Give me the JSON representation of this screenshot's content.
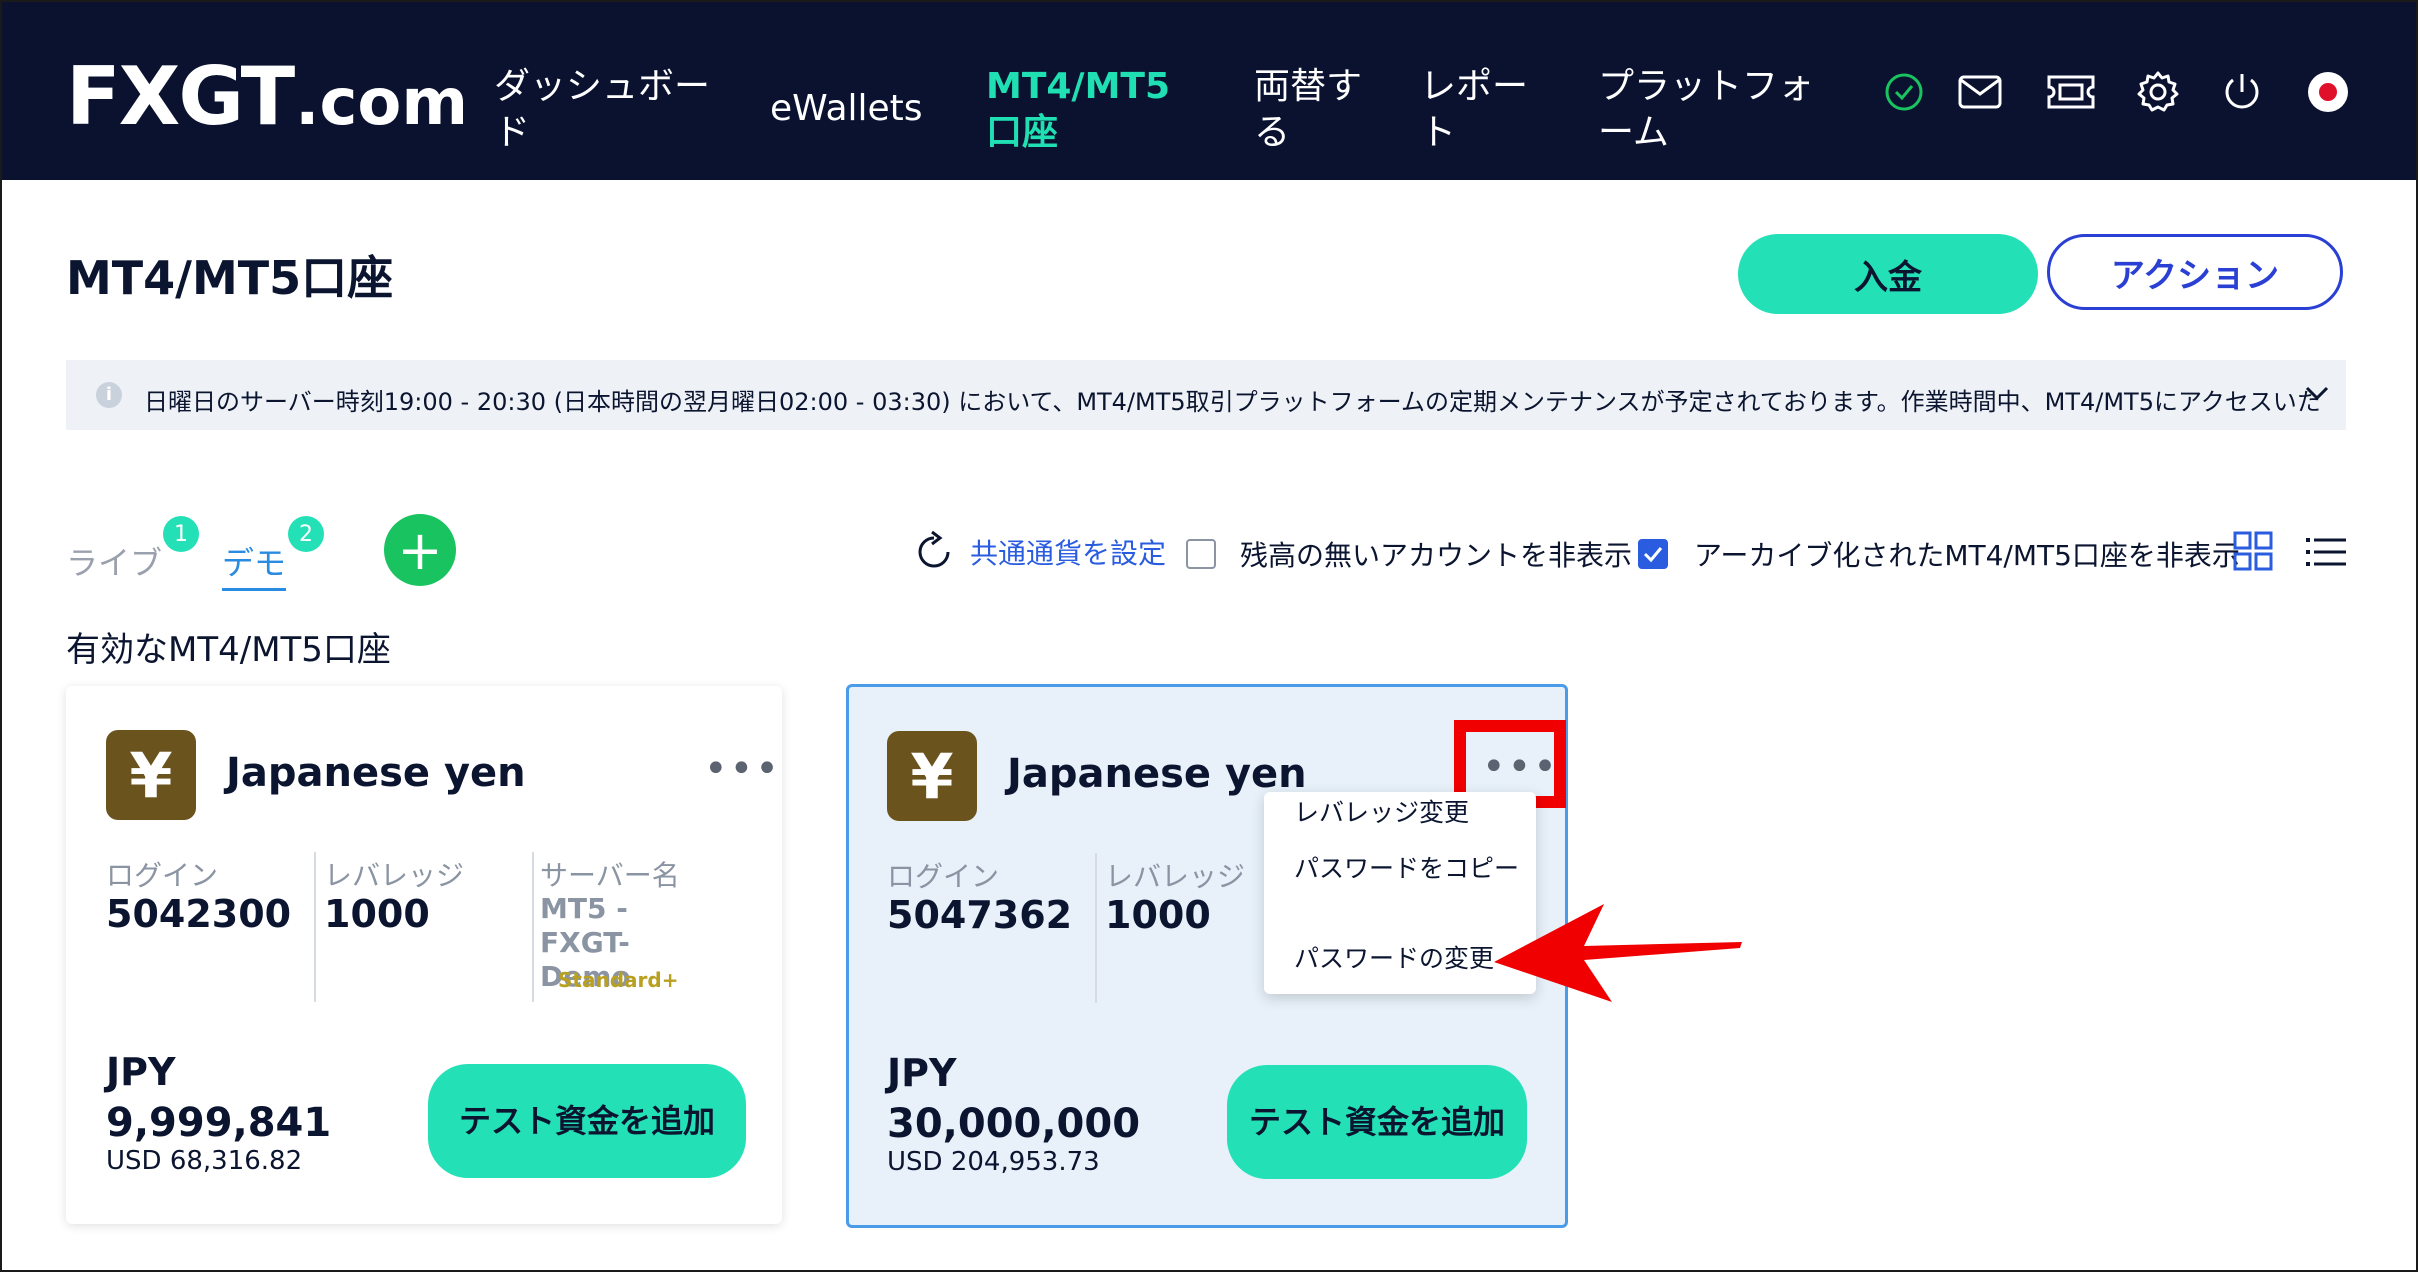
{
  "header": {
    "logo": {
      "fx": "FX",
      "gt": "GT",
      "com": ".com"
    },
    "nav": [
      {
        "label": "ダッシュボード"
      },
      {
        "label": "eWallets"
      },
      {
        "label": "MT4/MT5口座"
      },
      {
        "label": "両替する"
      },
      {
        "label": "レポート"
      },
      {
        "label": "プラットフォーム"
      }
    ],
    "icons": [
      "check-circle-icon",
      "mail-icon",
      "ticket-icon",
      "gear-icon",
      "power-icon",
      "japan-flag-icon"
    ]
  },
  "page": {
    "title": "MT4/MT5口座",
    "deposit_label": "入金",
    "action_label": "アクション"
  },
  "notice": {
    "text": "日曜日のサーバー時刻19:00 - 20:30 (日本時間の翌月曜日02:00 - 03:30) において、MT4/MT5取引プラットフォームの定期メンテナンスが予定されております。作業時間中、MT4/MT5にアクセスいた"
  },
  "tabs": {
    "live": {
      "label": "ライブ",
      "count": "1"
    },
    "demo": {
      "label": "デモ",
      "count": "2"
    }
  },
  "toolbar": {
    "set_currency": "共通通貨を設定",
    "hide_zero": "残高の無いアカウントを非表示",
    "hide_archived": "アーカイブ化されたMT4/MT5口座を非表示",
    "hide_zero_checked": false,
    "hide_archived_checked": true
  },
  "section_title": "有効なMT4/MT5口座",
  "cards": [
    {
      "currency_name": "Japanese yen",
      "currency_symbol": "¥",
      "login_label": "ログイン",
      "login": "5042300",
      "leverage_label": "レバレッジ",
      "leverage": "1000",
      "server_label": "サーバー名",
      "server": "MT5 - FXGT-Demo",
      "tier": "Standard+",
      "currency": "JPY",
      "balance": "9,999,841",
      "usd": "USD 68,316.82",
      "test_funds_label": "テスト資金を追加"
    },
    {
      "currency_name": "Japanese yen",
      "currency_symbol": "¥",
      "login_label": "ログイン",
      "login": "5047362",
      "leverage_label": "レバレッジ",
      "leverage": "1000",
      "currency": "JPY",
      "balance": "30,000,000",
      "usd": "USD 204,953.73",
      "test_funds_label": "テスト資金を追加"
    }
  ],
  "menu": {
    "items": [
      {
        "label": "レバレッジ変更"
      },
      {
        "label": "パスワードをコピー"
      },
      {
        "label": "パスワードの変更"
      }
    ]
  },
  "colors": {
    "header_bg": "#0a1230",
    "accent": "#23e0b6",
    "link_blue": "#2a5ce0",
    "highlight_red": "#f00000"
  }
}
